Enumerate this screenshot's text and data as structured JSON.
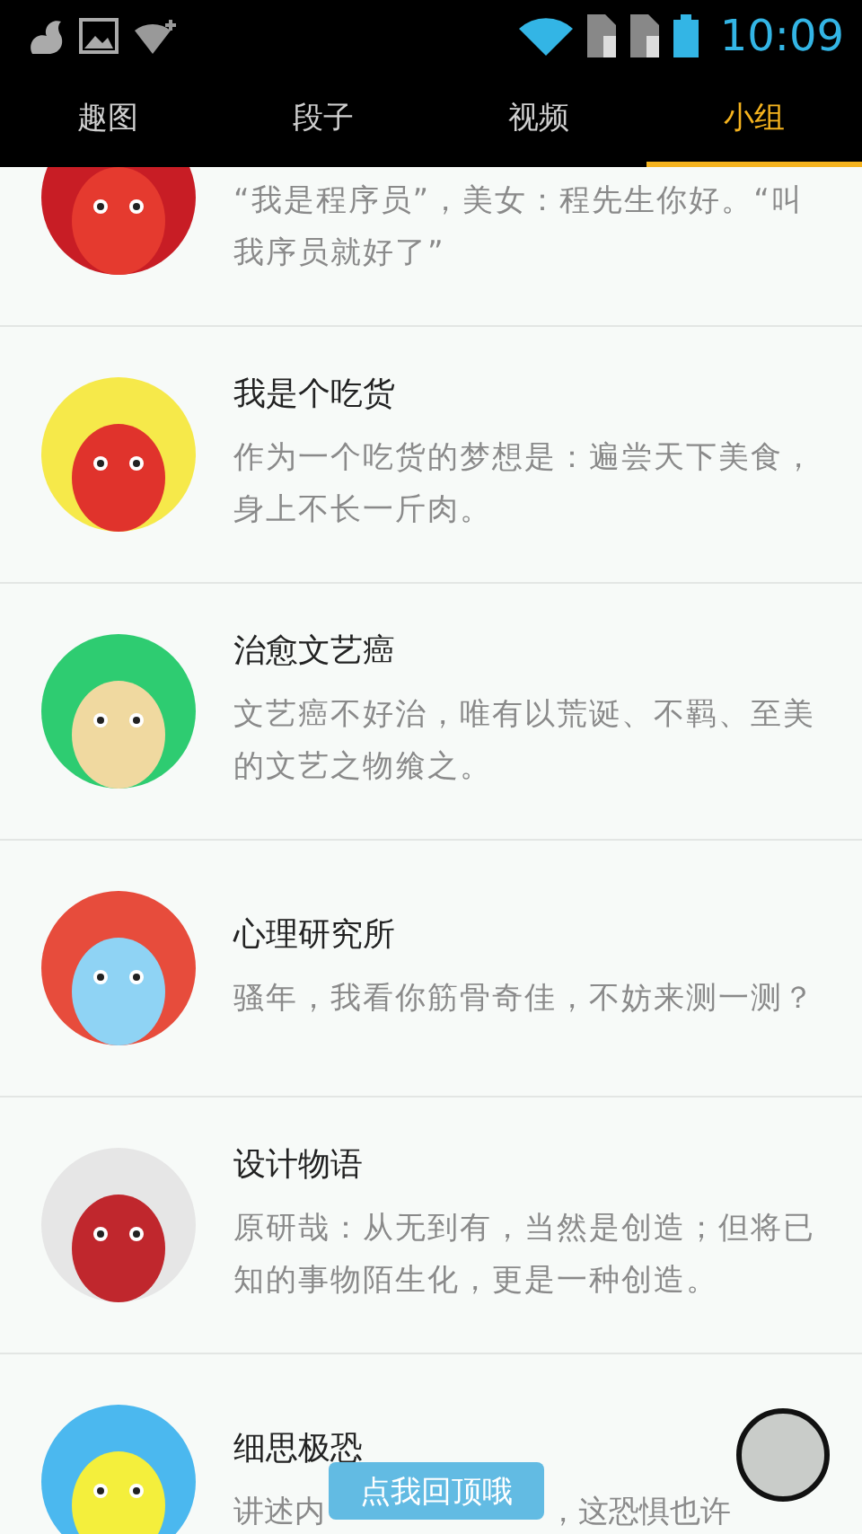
{
  "status_bar": {
    "time": "10:09"
  },
  "tabs": [
    {
      "label": "趣图",
      "selected": false
    },
    {
      "label": "段子",
      "selected": false
    },
    {
      "label": "视频",
      "selected": false
    },
    {
      "label": "小组",
      "selected": true
    }
  ],
  "groups": [
    {
      "description": "“我是程序员”，美女：程先生你好。“叫我序员就好了”"
    },
    {
      "title": "我是个吃货",
      "description": "作为一个吃货的梦想是：遍尝天下美食，身上不长一斤肉。"
    },
    {
      "title": "治愈文艺癌",
      "description": "文艺癌不好治，唯有以荒诞、不羁、至美的文艺之物飨之。"
    },
    {
      "title": "心理研究所",
      "description": "骚年，我看你筋骨奇佳，不妨来测一测？"
    },
    {
      "title": "设计物语",
      "description": "原研哉：从无到有，当然是创造；但将已知的事物陌生化，更是一种创造。"
    },
    {
      "title": "细思极恐",
      "description_parts": [
        "讲述内",
        "，这恐惧也许"
      ]
    }
  ],
  "back_to_top": {
    "label": "点我回顶哦"
  }
}
